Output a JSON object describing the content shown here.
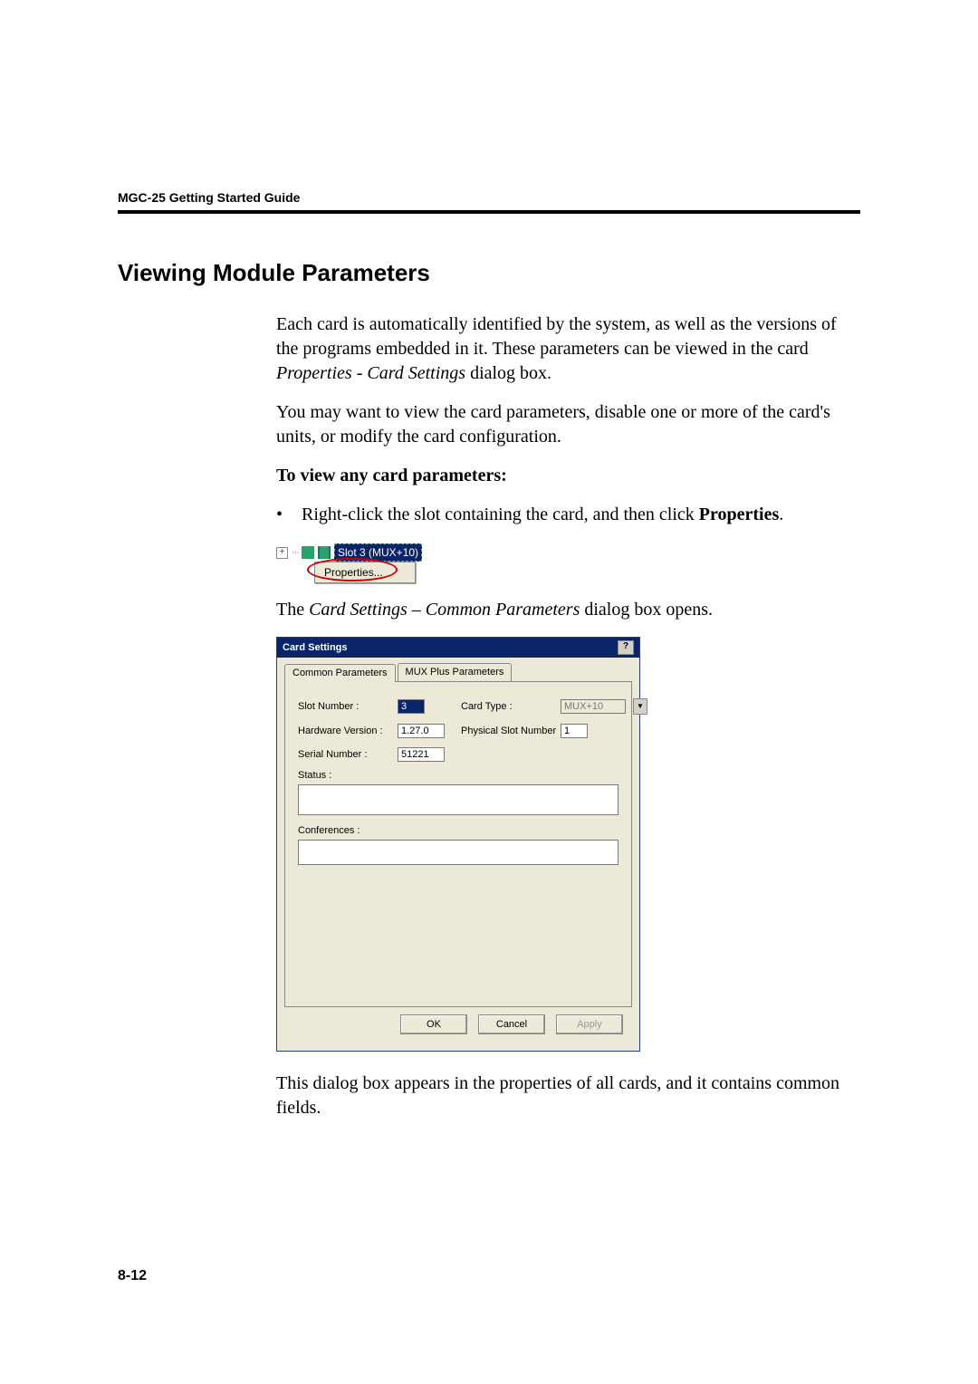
{
  "header": {
    "title": "MGC-25 Getting Started Guide"
  },
  "h2": "Viewing Module Parameters",
  "p1a": "Each card is automatically identified by the system, as well as the versions of the programs embedded in it. These parameters can be viewed in the card ",
  "p1b": "Properties - Card Settings",
  "p1c": " dialog box.",
  "p2": "You may want to view the card parameters, disable one or more of the card's units, or modify the card configuration.",
  "p3": "To view any card parameters:",
  "bullet_a": "Right-click the slot containing the card, and then click ",
  "bullet_b": "Properties",
  "bullet_c": ".",
  "tree": {
    "node_label": "Slot 3 (MUX+10)",
    "ctx_item": "Properties..."
  },
  "p4a": "The ",
  "p4b": "Card Settings – Common Parameters",
  "p4c": " dialog box opens.",
  "dlg": {
    "title": "Card Settings",
    "help": "?",
    "tab1": "Common Parameters",
    "tab2": "MUX Plus Parameters",
    "lbl_slot": "Slot Number :",
    "val_slot": "3",
    "lbl_cardtype": "Card Type :",
    "val_cardtype": "MUX+10",
    "lbl_hwver": "Hardware Version :",
    "val_hwver": "1.27.0",
    "lbl_physslot": "Physical Slot Number",
    "val_physslot": "1",
    "lbl_serial": "Serial Number :",
    "val_serial": "51221",
    "lbl_status": "Status :",
    "lbl_conf": "Conferences :",
    "btn_ok": "OK",
    "btn_cancel": "Cancel",
    "btn_apply": "Apply"
  },
  "p5": "This dialog box appears in the properties of all cards, and it contains common fields.",
  "pagenum": "8-12"
}
